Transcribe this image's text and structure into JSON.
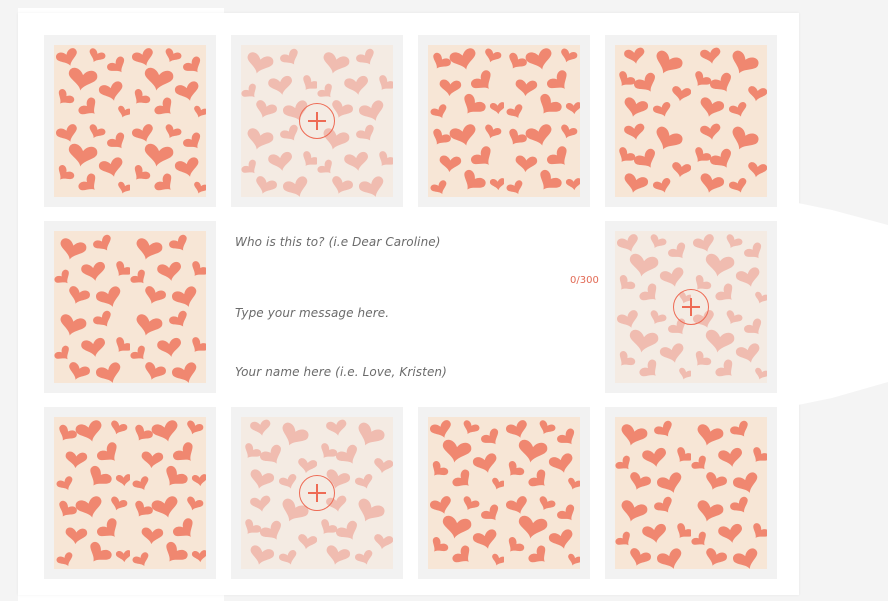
{
  "colors": {
    "heart": "#f08770",
    "tile_background": "#f7e6d6",
    "accent": "#ee6b55"
  },
  "tiles": [
    {
      "id": "r1c1",
      "state": "pattern"
    },
    {
      "id": "r1c2",
      "state": "empty-add"
    },
    {
      "id": "r1c3",
      "state": "pattern"
    },
    {
      "id": "r1c4",
      "state": "pattern"
    },
    {
      "id": "r2c1",
      "state": "pattern"
    },
    {
      "id": "r2c4",
      "state": "empty-add"
    },
    {
      "id": "r3c1",
      "state": "pattern"
    },
    {
      "id": "r3c2",
      "state": "empty-add"
    },
    {
      "id": "r3c3",
      "state": "pattern"
    },
    {
      "id": "r3c4",
      "state": "pattern"
    }
  ],
  "message": {
    "to_placeholder": "Who is this to? (i.e Dear Caroline)",
    "body_placeholder": "Type your message here.",
    "from_placeholder": "Your name here (i.e. Love, Kristen)",
    "char_count": "0/300"
  },
  "icons": {
    "add": "plus-circle-icon",
    "pattern": "hearts-pattern"
  }
}
